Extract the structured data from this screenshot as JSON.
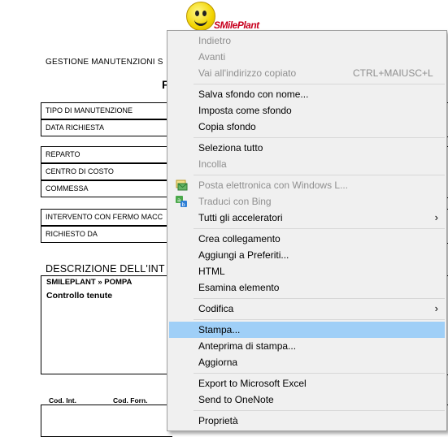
{
  "document": {
    "logo_text": "SMilePlant",
    "heading": "GESTIONE MANUTENZIONI S",
    "big_letter": "F",
    "fields": [
      "TIPO DI MANUTENZIONE",
      "DATA RICHIESTA",
      "REPARTO",
      "CENTRO DI COSTO",
      "COMMESSA",
      "INTERVENTO CON FERMO MACC",
      "RICHIESTO DA"
    ],
    "section_title": "DESCRIZIONE DELL'INT",
    "desc_line1": "SMILEPLANT » POMPA",
    "desc_line2": "Controllo tenute",
    "code_int": "Cod. Int.",
    "code_forn": "Cod. Forn."
  },
  "menu": {
    "items": [
      {
        "label": "Indietro",
        "disabled": true
      },
      {
        "label": "Avanti",
        "disabled": true
      },
      {
        "label": "Vai all'indirizzo copiato",
        "shortcut": "CTRL+MAIUSC+L",
        "disabled": true
      },
      {
        "label": "Salva sfondo con nome..."
      },
      {
        "label": "Imposta come sfondo"
      },
      {
        "label": "Copia sfondo"
      },
      {
        "label": "Seleziona tutto"
      },
      {
        "label": "Incolla",
        "disabled": true
      },
      {
        "label": "Posta elettronica con Windows L...",
        "disabled": true,
        "icon": "mail-icon"
      },
      {
        "label": "Traduci con Bing",
        "disabled": true,
        "icon": "translate-icon"
      },
      {
        "label": "Tutti gli acceleratori",
        "submenu": true
      },
      {
        "label": "Crea collegamento"
      },
      {
        "label": "Aggiungi a Preferiti..."
      },
      {
        "label": "HTML"
      },
      {
        "label": "Esamina elemento"
      },
      {
        "label": "Codifica",
        "submenu": true
      },
      {
        "label": "Stampa...",
        "highlighted": true
      },
      {
        "label": "Anteprima di stampa..."
      },
      {
        "label": "Aggiorna"
      },
      {
        "label": "Export to Microsoft Excel"
      },
      {
        "label": "Send to OneNote"
      },
      {
        "label": "Proprietà"
      }
    ],
    "submenu_arrow": "›"
  }
}
